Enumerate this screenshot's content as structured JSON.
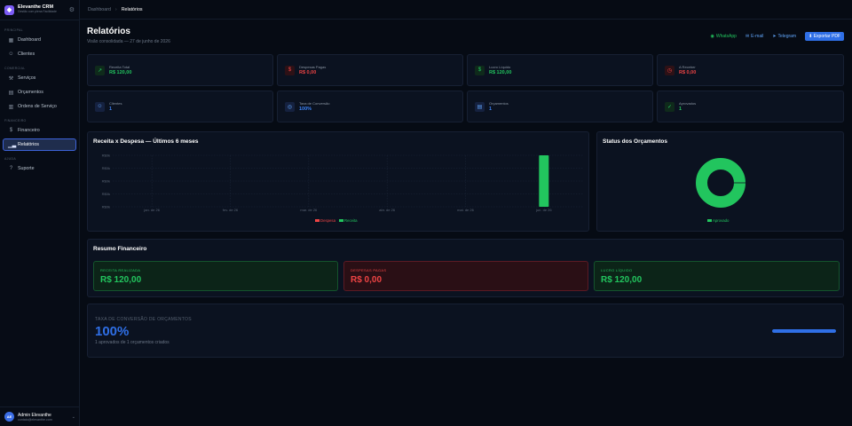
{
  "app": {
    "name": "Elevanthe CRM",
    "subtitle": "Gestão com plena Facilidade"
  },
  "sidebar": {
    "sections": [
      {
        "label": "PRINCIPAL",
        "items": [
          {
            "label": "Dashboard",
            "icon": "grid-icon"
          },
          {
            "label": "Clientes",
            "icon": "users-icon"
          }
        ]
      },
      {
        "label": "COMERCIAL",
        "items": [
          {
            "label": "Serviços",
            "icon": "wrench-icon"
          },
          {
            "label": "Orçamentos",
            "icon": "file-icon"
          },
          {
            "label": "Ordens de Serviço",
            "icon": "clipboard-icon"
          }
        ]
      },
      {
        "label": "FINANCEIRO",
        "items": [
          {
            "label": "Financeiro",
            "icon": "dollar-icon"
          },
          {
            "label": "Relatórios",
            "icon": "bar-chart-icon",
            "active": true
          }
        ]
      },
      {
        "label": "AJUDA",
        "items": [
          {
            "label": "Suporte",
            "icon": "help-icon"
          }
        ]
      }
    ]
  },
  "user": {
    "initials": "AE",
    "name": "Admin Elevanthe",
    "email": "contato@elevanthe.com"
  },
  "breadcrumb": {
    "root": "Dashboard",
    "current": "Relatórios"
  },
  "page": {
    "title": "Relatórios",
    "subtitle": "Visão consolidada — 27 de junho de 2026"
  },
  "actions": {
    "whatsapp": "WhatsApp",
    "email": "E-mail",
    "telegram": "Telegram",
    "export": "Exportar PDF"
  },
  "stats": [
    {
      "label": "Receita Total",
      "value": "R$ 120,00",
      "tone": "green",
      "icon": "trend-up-icon"
    },
    {
      "label": "Despesas Pagas",
      "value": "R$ 0,00",
      "tone": "red",
      "icon": "dollar-icon"
    },
    {
      "label": "Lucro Líquido",
      "value": "R$ 120,00",
      "tone": "green",
      "icon": "dollar-icon"
    },
    {
      "label": "A Receber",
      "value": "R$ 0,00",
      "tone": "red",
      "icon": "clock-icon"
    },
    {
      "label": "Clientes",
      "value": "1",
      "tone": "blue",
      "icon": "users-icon"
    },
    {
      "label": "Taxa de Conversão",
      "value": "100%",
      "tone": "blue",
      "icon": "target-icon"
    },
    {
      "label": "Orçamentos",
      "value": "1",
      "tone": "blue",
      "icon": "file-icon"
    },
    {
      "label": "Aprovados",
      "value": "1",
      "tone": "green",
      "icon": "check-icon"
    }
  ],
  "chart_data": [
    {
      "type": "bar",
      "title": "Receita x Despesa — Últimos 6 meses",
      "categories": [
        "jan. de 26",
        "fev. de 26",
        "mar. de 26",
        "abr. de 26",
        "mai. de 26",
        "jun. de 26"
      ],
      "y_ticks": [
        "R$0k",
        "R$0k",
        "R$0k",
        "R$0k",
        "R$0k"
      ],
      "ylim": [
        0,
        120
      ],
      "series": [
        {
          "name": "Despesa",
          "color": "#ef4444",
          "values": [
            0,
            0,
            0,
            0,
            0,
            0
          ]
        },
        {
          "name": "Receita",
          "color": "#22c55e",
          "values": [
            0,
            0,
            0,
            0,
            0,
            120
          ]
        }
      ],
      "legend": "bottom",
      "grid": true
    },
    {
      "type": "pie",
      "title": "Status dos Orçamentos",
      "slices": [
        {
          "name": "Aprovado",
          "value": 1,
          "color": "#22c55e"
        }
      ],
      "donut": true,
      "legend": "bottom"
    }
  ],
  "finance": {
    "title": "Resumo Financeiro",
    "items": [
      {
        "label": "RECEITA REALIZADA",
        "value": "R$ 120,00",
        "tone": "green"
      },
      {
        "label": "DESPESAS PAGAS",
        "value": "R$ 0,00",
        "tone": "red"
      },
      {
        "label": "LUCRO LÍQUIDO",
        "value": "R$ 120,00",
        "tone": "green"
      }
    ]
  },
  "conversion": {
    "label": "TAXA DE CONVERSÃO DE ORÇAMENTOS",
    "value": "100%",
    "sub": "1 aprovados de 1 orçamentos criados",
    "progress": 1.0
  },
  "colors": {
    "accent": "#2f6fe6",
    "green": "#22c55e",
    "red": "#ef4444",
    "bg": "#060b14",
    "card": "#0b1220"
  }
}
